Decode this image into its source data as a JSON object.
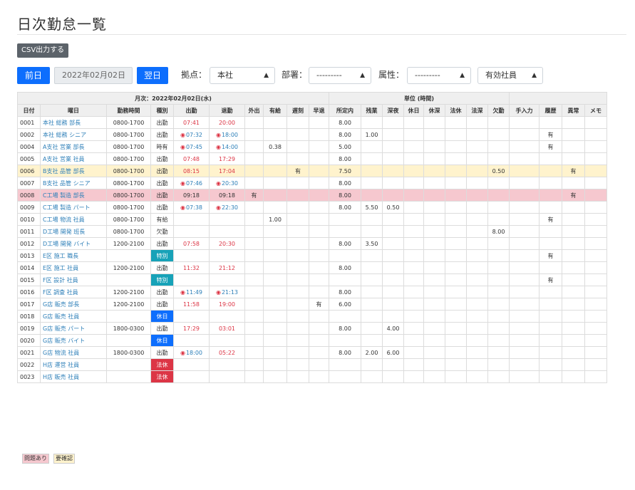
{
  "page": {
    "title": "日次勤怠一覧"
  },
  "toolbar": {
    "csv_label": "CSV出力する"
  },
  "datebar": {
    "prev_label": "前日",
    "date_value": "2022年02月02日",
    "next_label": "翌日"
  },
  "filters": {
    "base_label": "拠点：",
    "base_value": "本社",
    "dept_label": "部署：",
    "dept_value": "---------",
    "attr_label": "属性：",
    "attr_value": "---------",
    "status_value": "有効社員"
  },
  "table": {
    "group_left": "月次：2022年02月02日(水)",
    "group_right": "単位 (時間)",
    "headers": [
      "日付",
      "曜日",
      "勤務時間",
      "種別",
      "出勤",
      "退勤",
      "外出",
      "有給",
      "遅刻",
      "早退",
      "所定内",
      "残業",
      "深夜",
      "休日",
      "休深",
      "法休",
      "法深",
      "欠勤",
      "手入力",
      "履歴",
      "異常",
      "メモ"
    ],
    "rows": [
      {
        "no": "0001",
        "name": "本社 総務 部長",
        "shift": "0800-1700",
        "kind": "出勤",
        "kind_style": "",
        "in": "07:41",
        "in_pin": false,
        "in_color": "red",
        "out": "20:00",
        "out_pin": false,
        "out_color": "red",
        "gaisyutsu": "",
        "yukyu": "",
        "chikoku": "",
        "soutai": "",
        "shotei": "8.00",
        "zangyo": "",
        "shinya": "",
        "kyujitsu": "",
        "kyushin": "",
        "hokyu": "",
        "hoshin": "",
        "kekkin": "",
        "tenyu": "",
        "rireki": "",
        "ijo": "",
        "memo": "",
        "row_style": ""
      },
      {
        "no": "0002",
        "name": "本社 総務 シニア",
        "shift": "0800-1700",
        "kind": "出勤",
        "kind_style": "",
        "in": "07:32",
        "in_pin": true,
        "in_color": "blue",
        "out": "18:00",
        "out_pin": true,
        "out_color": "blue",
        "gaisyutsu": "",
        "yukyu": "",
        "chikoku": "",
        "soutai": "",
        "shotei": "8.00",
        "zangyo": "1.00",
        "shinya": "",
        "kyujitsu": "",
        "kyushin": "",
        "hokyu": "",
        "hoshin": "",
        "kekkin": "",
        "tenyu": "",
        "rireki": "有",
        "ijo": "",
        "memo": "",
        "row_style": ""
      },
      {
        "no": "0004",
        "name": "A支社 営業 部長",
        "shift": "0800-1700",
        "kind": "時有",
        "kind_style": "blue",
        "in": "07:45",
        "in_pin": true,
        "in_color": "blue",
        "out": "14:00",
        "out_pin": true,
        "out_color": "blue",
        "gaisyutsu": "",
        "yukyu": "0.38",
        "chikoku": "",
        "soutai": "",
        "shotei": "5.00",
        "zangyo": "",
        "shinya": "",
        "kyujitsu": "",
        "kyushin": "",
        "hokyu": "",
        "hoshin": "",
        "kekkin": "",
        "tenyu": "",
        "rireki": "有",
        "ijo": "",
        "memo": "",
        "row_style": ""
      },
      {
        "no": "0005",
        "name": "A支社 営業 社員",
        "shift": "0800-1700",
        "kind": "出勤",
        "kind_style": "",
        "in": "07:48",
        "in_pin": false,
        "in_color": "red",
        "out": "17:29",
        "out_pin": false,
        "out_color": "red",
        "gaisyutsu": "",
        "yukyu": "",
        "chikoku": "",
        "soutai": "",
        "shotei": "8.00",
        "zangyo": "",
        "shinya": "",
        "kyujitsu": "",
        "kyushin": "",
        "hokyu": "",
        "hoshin": "",
        "kekkin": "",
        "tenyu": "",
        "rireki": "",
        "ijo": "",
        "memo": "",
        "row_style": ""
      },
      {
        "no": "0006",
        "name": "B支社 品管 部長",
        "shift": "0800-1700",
        "kind": "出勤",
        "kind_style": "",
        "in": "08:15",
        "in_pin": false,
        "in_color": "red",
        "out": "17:04",
        "out_pin": false,
        "out_color": "red",
        "gaisyutsu": "",
        "yukyu": "",
        "chikoku": "有",
        "soutai": "",
        "shotei": "7.50",
        "zangyo": "",
        "shinya": "",
        "kyujitsu": "",
        "kyushin": "",
        "hokyu": "",
        "hoshin": "",
        "kekkin": "0.50",
        "tenyu": "",
        "rireki": "",
        "ijo": "有",
        "memo": "",
        "row_style": "yellow"
      },
      {
        "no": "0007",
        "name": "B支社 品管 シニア",
        "shift": "0800-1700",
        "kind": "出勤",
        "kind_style": "",
        "in": "07:46",
        "in_pin": true,
        "in_color": "blue",
        "out": "20:30",
        "out_pin": true,
        "out_color": "blue",
        "gaisyutsu": "",
        "yukyu": "",
        "chikoku": "",
        "soutai": "",
        "shotei": "8.00",
        "zangyo": "",
        "shinya": "",
        "kyujitsu": "",
        "kyushin": "",
        "hokyu": "",
        "hoshin": "",
        "kekkin": "",
        "tenyu": "",
        "rireki": "",
        "ijo": "",
        "memo": "",
        "row_style": ""
      },
      {
        "no": "0008",
        "name": "C工場 製造 部長",
        "shift": "0800-1700",
        "kind": "出勤",
        "kind_style": "",
        "in": "09:18",
        "in_pin": false,
        "in_color": "",
        "out": "09:18",
        "out_pin": false,
        "out_color": "",
        "gaisyutsu": "有",
        "yukyu": "",
        "chikoku": "",
        "soutai": "",
        "shotei": "8.00",
        "zangyo": "",
        "shinya": "",
        "kyujitsu": "",
        "kyushin": "",
        "hokyu": "",
        "hoshin": "",
        "kekkin": "",
        "tenyu": "",
        "rireki": "",
        "ijo": "有",
        "memo": "",
        "row_style": "pink"
      },
      {
        "no": "0009",
        "name": "C工場 製造 パート",
        "shift": "0800-1700",
        "kind": "出勤",
        "kind_style": "",
        "in": "07:38",
        "in_pin": true,
        "in_color": "blue",
        "out": "22:30",
        "out_pin": true,
        "out_color": "blue",
        "gaisyutsu": "",
        "yukyu": "",
        "chikoku": "",
        "soutai": "",
        "shotei": "8.00",
        "zangyo": "5.50",
        "shinya": "0.50",
        "kyujitsu": "",
        "kyushin": "",
        "hokyu": "",
        "hoshin": "",
        "kekkin": "",
        "tenyu": "",
        "rireki": "",
        "ijo": "",
        "memo": "",
        "row_style": ""
      },
      {
        "no": "0010",
        "name": "C工場 物流 社員",
        "shift": "0800-1700",
        "kind": "有給",
        "kind_style": "blue",
        "in": "",
        "in_pin": false,
        "in_color": "",
        "out": "",
        "out_pin": false,
        "out_color": "",
        "gaisyutsu": "",
        "yukyu": "1.00",
        "chikoku": "",
        "soutai": "",
        "shotei": "",
        "zangyo": "",
        "shinya": "",
        "kyujitsu": "",
        "kyushin": "",
        "hokyu": "",
        "hoshin": "",
        "kekkin": "",
        "tenyu": "",
        "rireki": "有",
        "ijo": "",
        "memo": "",
        "row_style": ""
      },
      {
        "no": "0011",
        "name": "D工場 開発 班長",
        "shift": "0800-1700",
        "kind": "欠勤",
        "kind_style": "red",
        "in": "",
        "in_pin": false,
        "in_color": "",
        "out": "",
        "out_pin": false,
        "out_color": "",
        "gaisyutsu": "",
        "yukyu": "",
        "chikoku": "",
        "soutai": "",
        "shotei": "",
        "zangyo": "",
        "shinya": "",
        "kyujitsu": "",
        "kyushin": "",
        "hokyu": "",
        "hoshin": "",
        "kekkin": "8.00",
        "tenyu": "",
        "rireki": "",
        "ijo": "",
        "memo": "",
        "row_style": ""
      },
      {
        "no": "0012",
        "name": "D工場 開発 バイト",
        "shift": "1200-2100",
        "kind": "出勤",
        "kind_style": "",
        "in": "07:58",
        "in_pin": false,
        "in_color": "red",
        "out": "20:30",
        "out_pin": false,
        "out_color": "red",
        "gaisyutsu": "",
        "yukyu": "",
        "chikoku": "",
        "soutai": "",
        "shotei": "8.00",
        "zangyo": "3.50",
        "shinya": "",
        "kyujitsu": "",
        "kyushin": "",
        "hokyu": "",
        "hoshin": "",
        "kekkin": "",
        "tenyu": "",
        "rireki": "",
        "ijo": "",
        "memo": "",
        "row_style": ""
      },
      {
        "no": "0013",
        "name": "E区 施工 職長",
        "shift": "",
        "kind": "特別",
        "kind_style": "b-teal",
        "in": "",
        "in_pin": false,
        "in_color": "",
        "out": "",
        "out_pin": false,
        "out_color": "",
        "gaisyutsu": "",
        "yukyu": "",
        "chikoku": "",
        "soutai": "",
        "shotei": "",
        "zangyo": "",
        "shinya": "",
        "kyujitsu": "",
        "kyushin": "",
        "hokyu": "",
        "hoshin": "",
        "kekkin": "",
        "tenyu": "",
        "rireki": "有",
        "ijo": "",
        "memo": "",
        "row_style": ""
      },
      {
        "no": "0014",
        "name": "E区 施工 社員",
        "shift": "1200-2100",
        "kind": "出勤",
        "kind_style": "",
        "in": "11:32",
        "in_pin": false,
        "in_color": "red",
        "out": "21:12",
        "out_pin": false,
        "out_color": "red",
        "gaisyutsu": "",
        "yukyu": "",
        "chikoku": "",
        "soutai": "",
        "shotei": "8.00",
        "zangyo": "",
        "shinya": "",
        "kyujitsu": "",
        "kyushin": "",
        "hokyu": "",
        "hoshin": "",
        "kekkin": "",
        "tenyu": "",
        "rireki": "",
        "ijo": "",
        "memo": "",
        "row_style": ""
      },
      {
        "no": "0015",
        "name": "F区 設計 社員",
        "shift": "",
        "kind": "特別",
        "kind_style": "b-teal",
        "in": "",
        "in_pin": false,
        "in_color": "",
        "out": "",
        "out_pin": false,
        "out_color": "",
        "gaisyutsu": "",
        "yukyu": "",
        "chikoku": "",
        "soutai": "",
        "shotei": "",
        "zangyo": "",
        "shinya": "",
        "kyujitsu": "",
        "kyushin": "",
        "hokyu": "",
        "hoshin": "",
        "kekkin": "",
        "tenyu": "",
        "rireki": "有",
        "ijo": "",
        "memo": "",
        "row_style": ""
      },
      {
        "no": "0016",
        "name": "F区 調査 社員",
        "shift": "1200-2100",
        "kind": "出勤",
        "kind_style": "",
        "in": "11:49",
        "in_pin": true,
        "in_color": "blue",
        "out": "21:13",
        "out_pin": true,
        "out_color": "blue",
        "gaisyutsu": "",
        "yukyu": "",
        "chikoku": "",
        "soutai": "",
        "shotei": "8.00",
        "zangyo": "",
        "shinya": "",
        "kyujitsu": "",
        "kyushin": "",
        "hokyu": "",
        "hoshin": "",
        "kekkin": "",
        "tenyu": "",
        "rireki": "",
        "ijo": "",
        "memo": "",
        "row_style": ""
      },
      {
        "no": "0017",
        "name": "G店 販売 部長",
        "shift": "1200-2100",
        "kind": "出勤",
        "kind_style": "",
        "in": "11:58",
        "in_pin": false,
        "in_color": "red",
        "out": "19:00",
        "out_pin": false,
        "out_color": "red",
        "gaisyutsu": "",
        "yukyu": "",
        "chikoku": "",
        "soutai": "有",
        "shotei": "6.00",
        "zangyo": "",
        "shinya": "",
        "kyujitsu": "",
        "kyushin": "",
        "hokyu": "",
        "hoshin": "",
        "kekkin": "",
        "tenyu": "",
        "rireki": "",
        "ijo": "",
        "memo": "",
        "row_style": ""
      },
      {
        "no": "0018",
        "name": "G店 販売 社員",
        "shift": "",
        "kind": "休日",
        "kind_style": "b-blue",
        "in": "",
        "in_pin": false,
        "in_color": "",
        "out": "",
        "out_pin": false,
        "out_color": "",
        "gaisyutsu": "",
        "yukyu": "",
        "chikoku": "",
        "soutai": "",
        "shotei": "",
        "zangyo": "",
        "shinya": "",
        "kyujitsu": "",
        "kyushin": "",
        "hokyu": "",
        "hoshin": "",
        "kekkin": "",
        "tenyu": "",
        "rireki": "",
        "ijo": "",
        "memo": "",
        "row_style": ""
      },
      {
        "no": "0019",
        "name": "G店 販売 パート",
        "shift": "1800-0300",
        "kind": "出勤",
        "kind_style": "",
        "in": "17:29",
        "in_pin": false,
        "in_color": "red",
        "out": "03:01",
        "out_pin": false,
        "out_color": "red",
        "gaisyutsu": "",
        "yukyu": "",
        "chikoku": "",
        "soutai": "",
        "shotei": "8.00",
        "zangyo": "",
        "shinya": "4.00",
        "kyujitsu": "",
        "kyushin": "",
        "hokyu": "",
        "hoshin": "",
        "kekkin": "",
        "tenyu": "",
        "rireki": "",
        "ijo": "",
        "memo": "",
        "row_style": ""
      },
      {
        "no": "0020",
        "name": "G店 販売 バイト",
        "shift": "",
        "kind": "休日",
        "kind_style": "b-blue",
        "in": "",
        "in_pin": false,
        "in_color": "",
        "out": "",
        "out_pin": false,
        "out_color": "",
        "gaisyutsu": "",
        "yukyu": "",
        "chikoku": "",
        "soutai": "",
        "shotei": "",
        "zangyo": "",
        "shinya": "",
        "kyujitsu": "",
        "kyushin": "",
        "hokyu": "",
        "hoshin": "",
        "kekkin": "",
        "tenyu": "",
        "rireki": "",
        "ijo": "",
        "memo": "",
        "row_style": ""
      },
      {
        "no": "0021",
        "name": "G店 物流 社員",
        "shift": "1800-0300",
        "kind": "出勤",
        "kind_style": "",
        "in": "18:00",
        "in_pin": true,
        "in_color": "blue",
        "out": "05:22",
        "out_pin": false,
        "out_color": "red",
        "gaisyutsu": "",
        "yukyu": "",
        "chikoku": "",
        "soutai": "",
        "shotei": "8.00",
        "zangyo": "2.00",
        "shinya": "6.00",
        "kyujitsu": "",
        "kyushin": "",
        "hokyu": "",
        "hoshin": "",
        "kekkin": "",
        "tenyu": "",
        "rireki": "",
        "ijo": "",
        "memo": "",
        "row_style": ""
      },
      {
        "no": "0022",
        "name": "H店 運営 社員",
        "shift": "",
        "kind": "法休",
        "kind_style": "b-red",
        "in": "",
        "in_pin": false,
        "in_color": "",
        "out": "",
        "out_pin": false,
        "out_color": "",
        "gaisyutsu": "",
        "yukyu": "",
        "chikoku": "",
        "soutai": "",
        "shotei": "",
        "zangyo": "",
        "shinya": "",
        "kyujitsu": "",
        "kyushin": "",
        "hokyu": "",
        "hoshin": "",
        "kekkin": "",
        "tenyu": "",
        "rireki": "",
        "ijo": "",
        "memo": "",
        "row_style": ""
      },
      {
        "no": "0023",
        "name": "H店 販売 社員",
        "shift": "",
        "kind": "法休",
        "kind_style": "b-red",
        "in": "",
        "in_pin": false,
        "in_color": "",
        "out": "",
        "out_pin": false,
        "out_color": "",
        "gaisyutsu": "",
        "yukyu": "",
        "chikoku": "",
        "soutai": "",
        "shotei": "",
        "zangyo": "",
        "shinya": "",
        "kyujitsu": "",
        "kyushin": "",
        "hokyu": "",
        "hoshin": "",
        "kekkin": "",
        "tenyu": "",
        "rireki": "",
        "ijo": "",
        "memo": "",
        "row_style": ""
      }
    ]
  },
  "legend": {
    "problem": "問題あり",
    "confirm": "要確認"
  },
  "colors": {
    "primary": "#0d6efd",
    "danger": "#dc3545",
    "info": "#17a2b8",
    "link": "#2d7fb8",
    "warning_row": "#fff3cd",
    "danger_row": "#f6c8cf"
  },
  "icons": {
    "pin": "map-pin-icon",
    "select": "chevron-updown-icon"
  }
}
